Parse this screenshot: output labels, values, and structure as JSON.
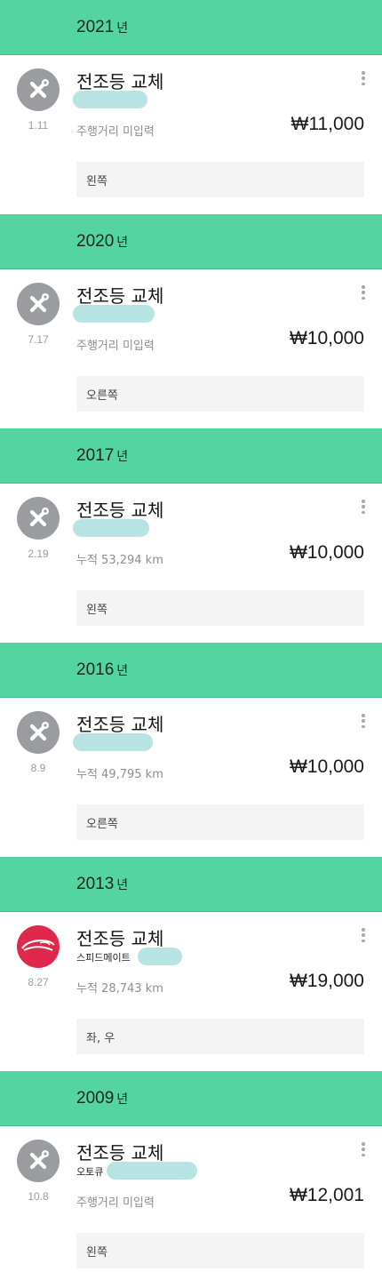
{
  "colors": {
    "header": "#54d4a0",
    "note_bg": "#f4f4f4",
    "icon_gray": "#9a9ca0",
    "icon_red": "#e0284c"
  },
  "year_suffix": "년",
  "records": [
    {
      "year": "2021",
      "title": "전조등 교체",
      "subtitle": "",
      "date": "1.11",
      "distance": "주행거리 미입력",
      "price": "₩11,000",
      "note": "왼쪽",
      "icon": "wrench-icon"
    },
    {
      "year": "2020",
      "title": "전조등 교체",
      "subtitle": "",
      "date": "7.17",
      "distance": "주행거리 미입력",
      "price": "₩10,000",
      "note": "오른쪽",
      "icon": "wrench-icon"
    },
    {
      "year": "2017",
      "title": "전조등 교체",
      "subtitle": "",
      "date": "2.19",
      "distance": "누적 53,294 km",
      "price": "₩10,000",
      "note": "왼쪽",
      "icon": "wrench-icon"
    },
    {
      "year": "2016",
      "title": "전조등 교체",
      "subtitle": "",
      "date": "8.9",
      "distance": "누적 49,795 km",
      "price": "₩10,000",
      "note": "오른쪽",
      "icon": "wrench-icon"
    },
    {
      "year": "2013",
      "title": "전조등 교체",
      "subtitle": "스피드메이트",
      "date": "8.27",
      "distance": "누적 28,743 km",
      "price": "₩19,000",
      "note": "좌, 우",
      "icon": "speedmate-logo-icon"
    },
    {
      "year": "2009",
      "title": "전조등 교체",
      "subtitle": "오토큐",
      "date": "10.8",
      "distance": "주행거리 미입력",
      "price": "₩12,001",
      "note": "왼쪽",
      "icon": "wrench-icon"
    }
  ]
}
